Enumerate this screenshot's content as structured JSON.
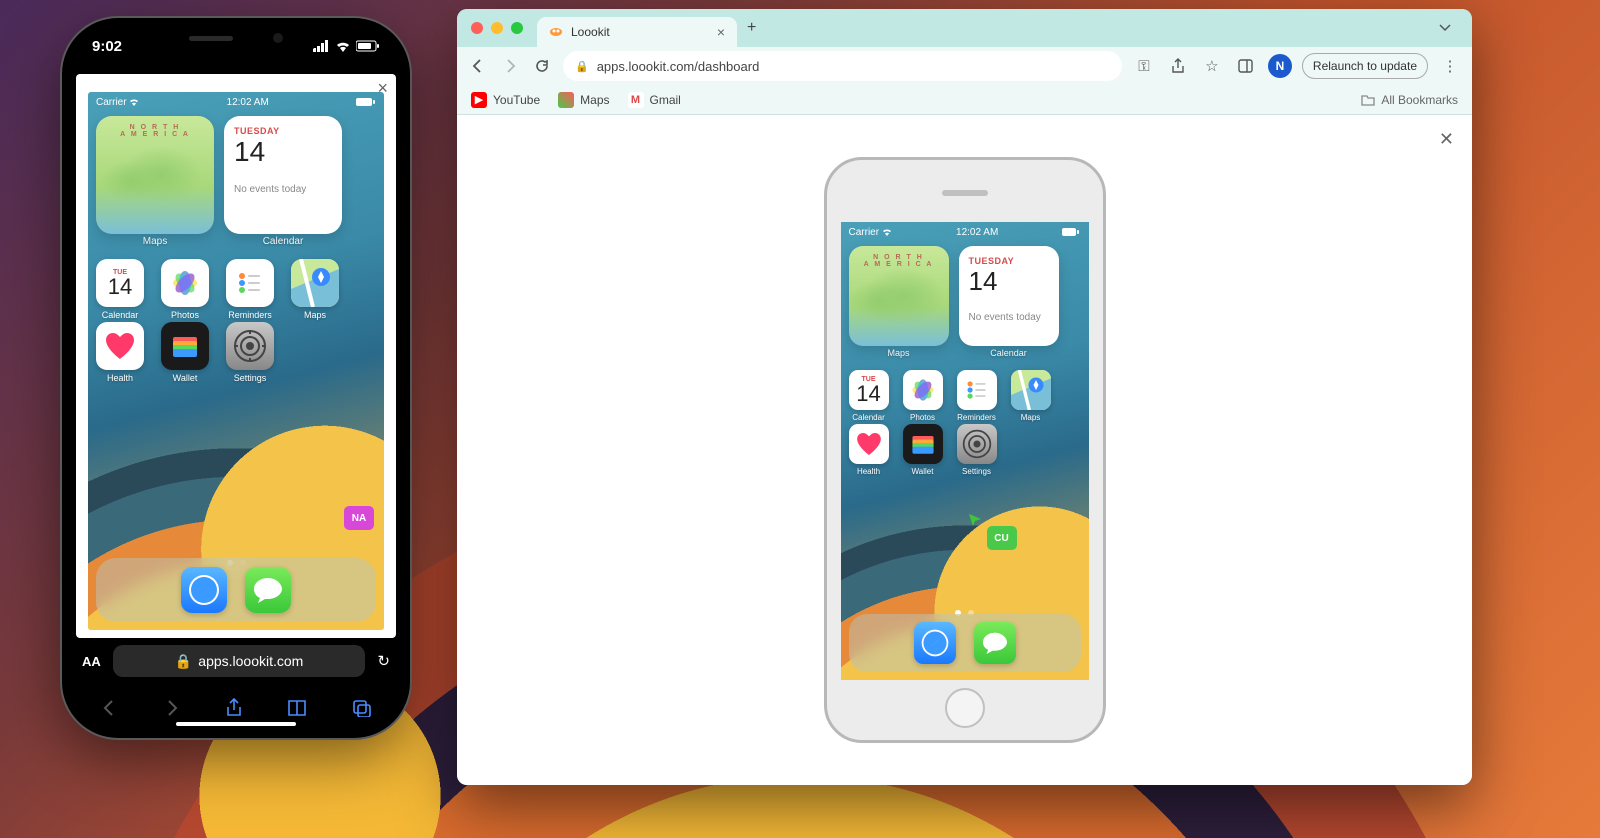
{
  "left_phone": {
    "status_time": "9:02",
    "safari_close": "×",
    "safari_aa": "AA",
    "safari_lock": "🔒",
    "safari_domain": "apps.loookit.com",
    "safari_reload": "↻"
  },
  "ios": {
    "carrier": "Carrier",
    "time": "12:02 AM",
    "maps_na": "N O R T H\nA M E R I C A",
    "maps_label": "Maps",
    "cal_day": "TUESDAY",
    "cal_num": "14",
    "cal_none": "No events today",
    "cal_label": "Calendar",
    "appcal_day": "TUE",
    "appcal_num": "14",
    "apps": {
      "calendar": "Calendar",
      "photos": "Photos",
      "reminders": "Reminders",
      "maps": "Maps",
      "health": "Health",
      "wallet": "Wallet",
      "settings": "Settings"
    }
  },
  "cursor": {
    "na": "NA",
    "cu": "CU"
  },
  "chrome": {
    "tab_title": "Loookit",
    "tab_close": "×",
    "new_tab": "+",
    "url": "apps.loookit.com/dashboard",
    "relaunch": "Relaunch to update",
    "avatar": "N",
    "bookmarks": {
      "youtube": "YouTube",
      "maps": "Maps",
      "gmail": "Gmail",
      "all": "All Bookmarks"
    },
    "page_close": "✕"
  }
}
